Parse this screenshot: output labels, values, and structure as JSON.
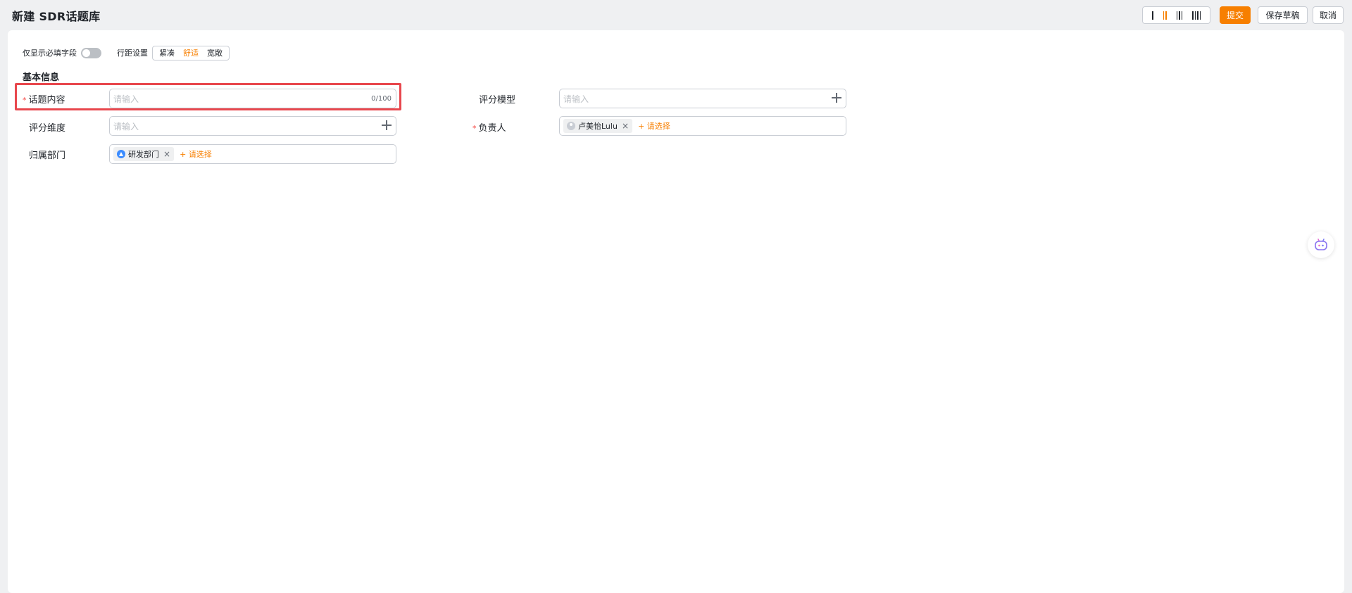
{
  "header": {
    "title": "新建 SDR话题库",
    "submit_label": "提交",
    "save_draft_label": "保存草稿",
    "cancel_label": "取消",
    "column_options": [
      "1",
      "2",
      "3",
      "4"
    ],
    "active_column_option": "2"
  },
  "settings": {
    "required_only_label": "仅显示必填字段",
    "required_only_on": false,
    "spacing_label": "行距设置",
    "spacing_options": [
      "紧凑",
      "舒适",
      "宽敞"
    ],
    "spacing_selected": "舒适"
  },
  "form": {
    "section_title": "基本信息",
    "topic_content": {
      "label": "话题内容",
      "required_mark": "*",
      "placeholder": "请输入",
      "counter": "0/100"
    },
    "scoring_model": {
      "label": "评分模型",
      "placeholder": "请输入"
    },
    "scoring_dimension": {
      "label": "评分维度",
      "placeholder": "请输入"
    },
    "owner": {
      "label": "负责人",
      "required_mark": "*",
      "tag": "卢美怡Lulu",
      "add_label": "+ 请选择"
    },
    "department": {
      "label": "归属部门",
      "tag": "研发部门",
      "add_label": "+ 请选择"
    }
  },
  "colors": {
    "accent": "#f77f00",
    "required": "#f54a45",
    "highlight": "#e8474d"
  }
}
